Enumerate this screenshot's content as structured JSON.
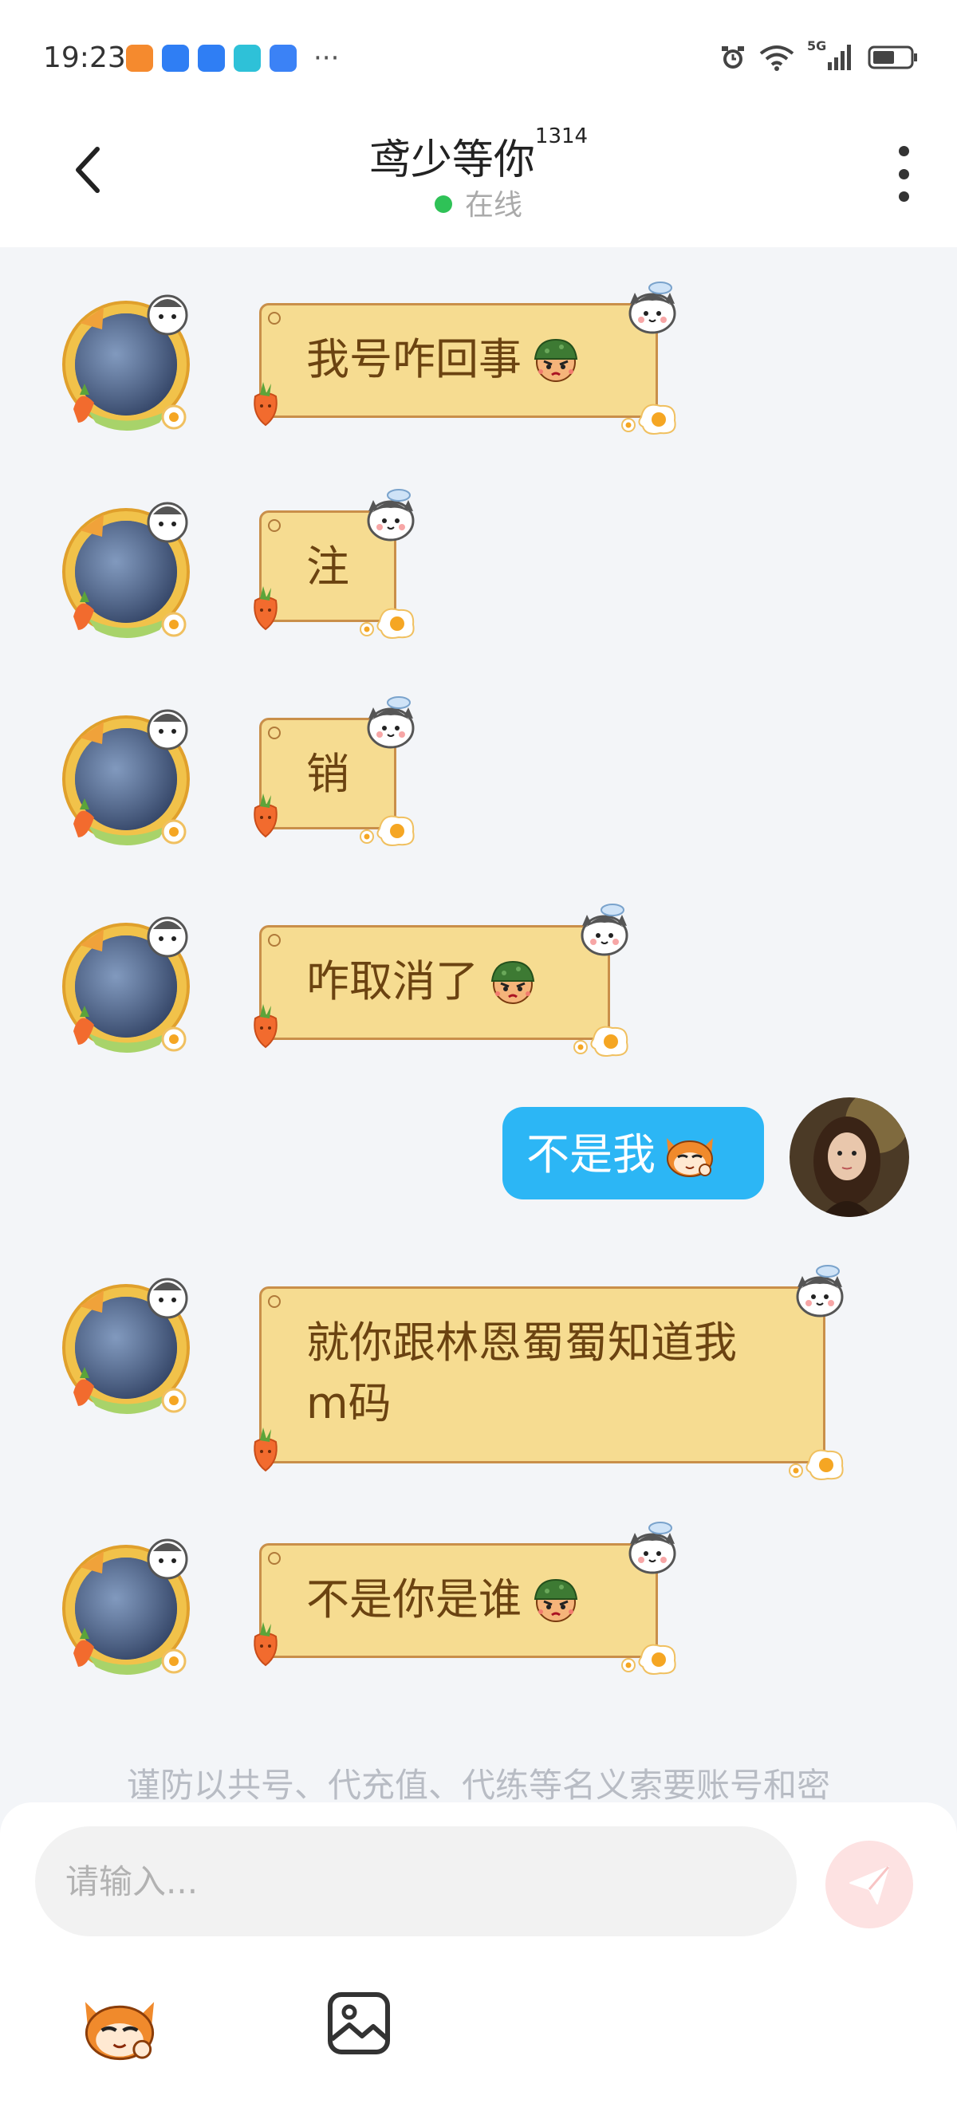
{
  "status_bar": {
    "time": "19:23",
    "network": "5G",
    "app_icon_colors": [
      "#f58a2e",
      "#2f7ef4",
      "#2f7ef4",
      "#2ec1d8",
      "#3b82f6"
    ]
  },
  "header": {
    "title": "鸢少等你",
    "title_badge": "1314",
    "status": "在线"
  },
  "messages": [
    {
      "side": "left",
      "text": "我号咋回事",
      "emoji": "helmet-angry-emoji"
    },
    {
      "side": "left",
      "text": "注",
      "emoji": ""
    },
    {
      "side": "left",
      "text": "销",
      "emoji": ""
    },
    {
      "side": "left",
      "text": "咋取消了",
      "emoji": "helmet-angry-emoji"
    },
    {
      "side": "right",
      "text": "不是我",
      "emoji": "fox-smug-emoji"
    },
    {
      "side": "left",
      "text": "就你跟林恩蜀蜀知道我",
      "text2": "m码",
      "emoji": ""
    },
    {
      "side": "left",
      "text": "不是你是谁",
      "emoji": "helmet-angry-emoji"
    }
  ],
  "warning": "谨防以共号、代充值、代练等名义索要账号和密",
  "input": {
    "placeholder": "请输入..."
  },
  "colors": {
    "bubble_left": "#f6dc91",
    "bubble_left_border": "#c98f4a",
    "bubble_right": "#2cb6f5",
    "online_dot": "#2fc257",
    "send_button": "#fde2e2"
  }
}
